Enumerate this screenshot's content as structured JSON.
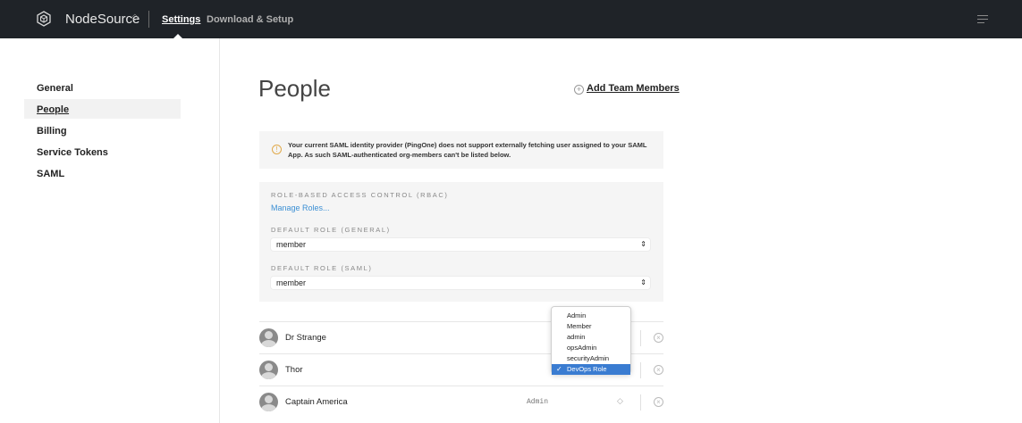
{
  "topbar": {
    "brand": "NodeSource",
    "brand_chevron": "◇",
    "nav": [
      {
        "label": "Settings",
        "active": true
      },
      {
        "label": "Download & Setup",
        "active": false
      }
    ],
    "logo_icon": "nodesource-cube-icon",
    "menu_icon": "hamburger-icon",
    "background": "#1f2328"
  },
  "sidebar": {
    "items": [
      {
        "label": "General"
      },
      {
        "label": "People",
        "active": true
      },
      {
        "label": "Billing"
      },
      {
        "label": "Service Tokens"
      },
      {
        "label": "SAML"
      }
    ]
  },
  "main": {
    "title": "People",
    "add_team_members": "Add Team Members",
    "notice": {
      "icon": "warning-circle-icon",
      "text": "Your current SAML identity provider (PingOne) does not support externally fetching user assigned to your SAML App. As such SAML-authenticated org-members can't be listed below."
    },
    "rbac": {
      "heading": "ROLE-BASED ACCESS CONTROL (RBAC)",
      "manage_roles": "Manage Roles...",
      "default_general_label": "DEFAULT ROLE (GENERAL)",
      "default_general_value": "member",
      "default_saml_label": "DEFAULT ROLE (SAML)",
      "default_saml_value": "member",
      "select_arrows": "⇕"
    },
    "people": [
      {
        "name": "Dr Strange",
        "role": ""
      },
      {
        "name": "Thor",
        "role": ""
      },
      {
        "name": "Captain America",
        "role": "Admin"
      }
    ],
    "role_dropdown": {
      "options": [
        "Admin",
        "Member",
        "admin",
        "opsAdmin",
        "securityAdmin",
        "DevOps Role"
      ],
      "selected": "DevOps Role"
    }
  },
  "colors": {
    "accent_link": "#3b8fd4",
    "selected_option": "#3a7cd1",
    "warning": "#e0a94a"
  }
}
